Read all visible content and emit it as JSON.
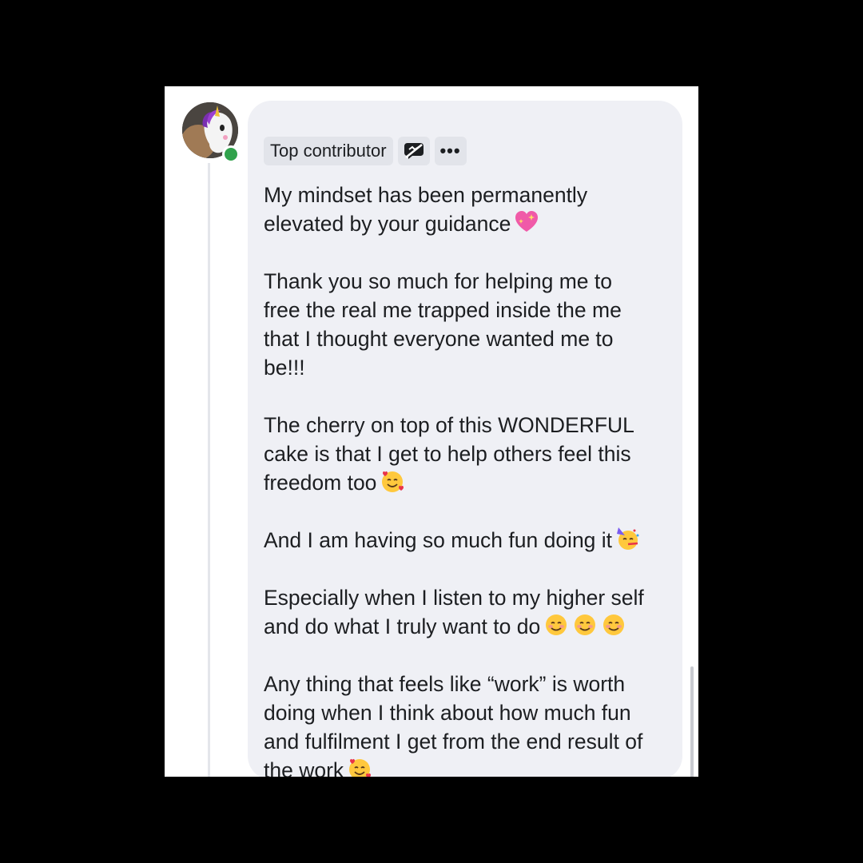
{
  "comment": {
    "badge_label": "Top contributor",
    "more_label": "•••",
    "paragraphs": [
      {
        "text": "My mindset has been permanently\nelevated by your guidance",
        "emoji": [
          "sparkling-heart"
        ]
      },
      {
        "text": "Thank you so much for helping me to\nfree the real me trapped inside the me\nthat I thought everyone wanted me to\nbe!!!",
        "emoji": []
      },
      {
        "text": "The cherry on top of this WONDERFUL\ncake is that I get to help others feel this\nfreedom too",
        "emoji": [
          "smiling-face-with-hearts"
        ]
      },
      {
        "text": "And I am having so much fun doing it",
        "emoji": [
          "partying-face"
        ]
      },
      {
        "text": "Especially when I listen to my higher self\nand do what I truly want to do",
        "emoji": [
          "smiling-face",
          "smiling-face",
          "smiling-face"
        ]
      },
      {
        "text": "Any thing that feels like “work” is worth\ndoing when I think about how much fun\nand fulfilment I get from the end result of\nthe work",
        "emoji": [
          "smiling-face-with-hearts"
        ]
      }
    ]
  },
  "colors": {
    "bubble": "#eff0f5",
    "badge": "#e2e4ea",
    "text": "#1c1e21",
    "online": "#31a24c"
  }
}
